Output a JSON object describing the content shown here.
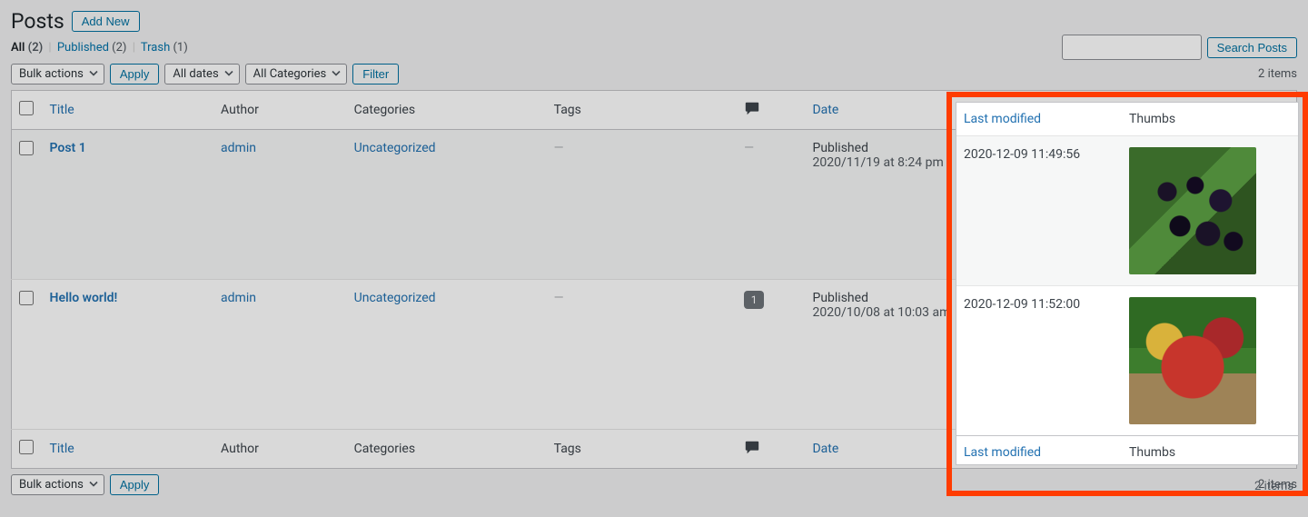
{
  "header": {
    "title": "Posts",
    "add_new": "Add New"
  },
  "filters_row": {
    "all_label": "All",
    "all_count": "(2)",
    "published_label": "Published",
    "published_count": "(2)",
    "trash_label": "Trash",
    "trash_count": "(1)"
  },
  "search": {
    "button": "Search Posts"
  },
  "top": {
    "bulk": "Bulk actions",
    "apply": "Apply",
    "dates": "All dates",
    "cats": "All Categories",
    "filter": "Filter",
    "items_count": "2 items"
  },
  "columns": {
    "title": "Title",
    "author": "Author",
    "categories": "Categories",
    "tags": "Tags",
    "date": "Date",
    "last_modified": "Last modified",
    "thumbs": "Thumbs"
  },
  "rows": [
    {
      "title": "Post 1",
      "author": "admin",
      "category": "Uncategorized",
      "tags": "—",
      "comments": "—",
      "status": "Published",
      "date": "2020/11/19 at 8:24 pm",
      "modified": "2020-12-09 11:49:56",
      "thumb_kind": "berries"
    },
    {
      "title": "Hello world!",
      "author": "admin",
      "category": "Uncategorized",
      "tags": "—",
      "comments": "1",
      "status": "Published",
      "date": "2020/10/08 at 10:03 am",
      "modified": "2020-12-09 11:52:00",
      "thumb_kind": "apples"
    }
  ],
  "bottom": {
    "bulk": "Bulk actions",
    "apply": "Apply",
    "items_count": "2 items"
  }
}
